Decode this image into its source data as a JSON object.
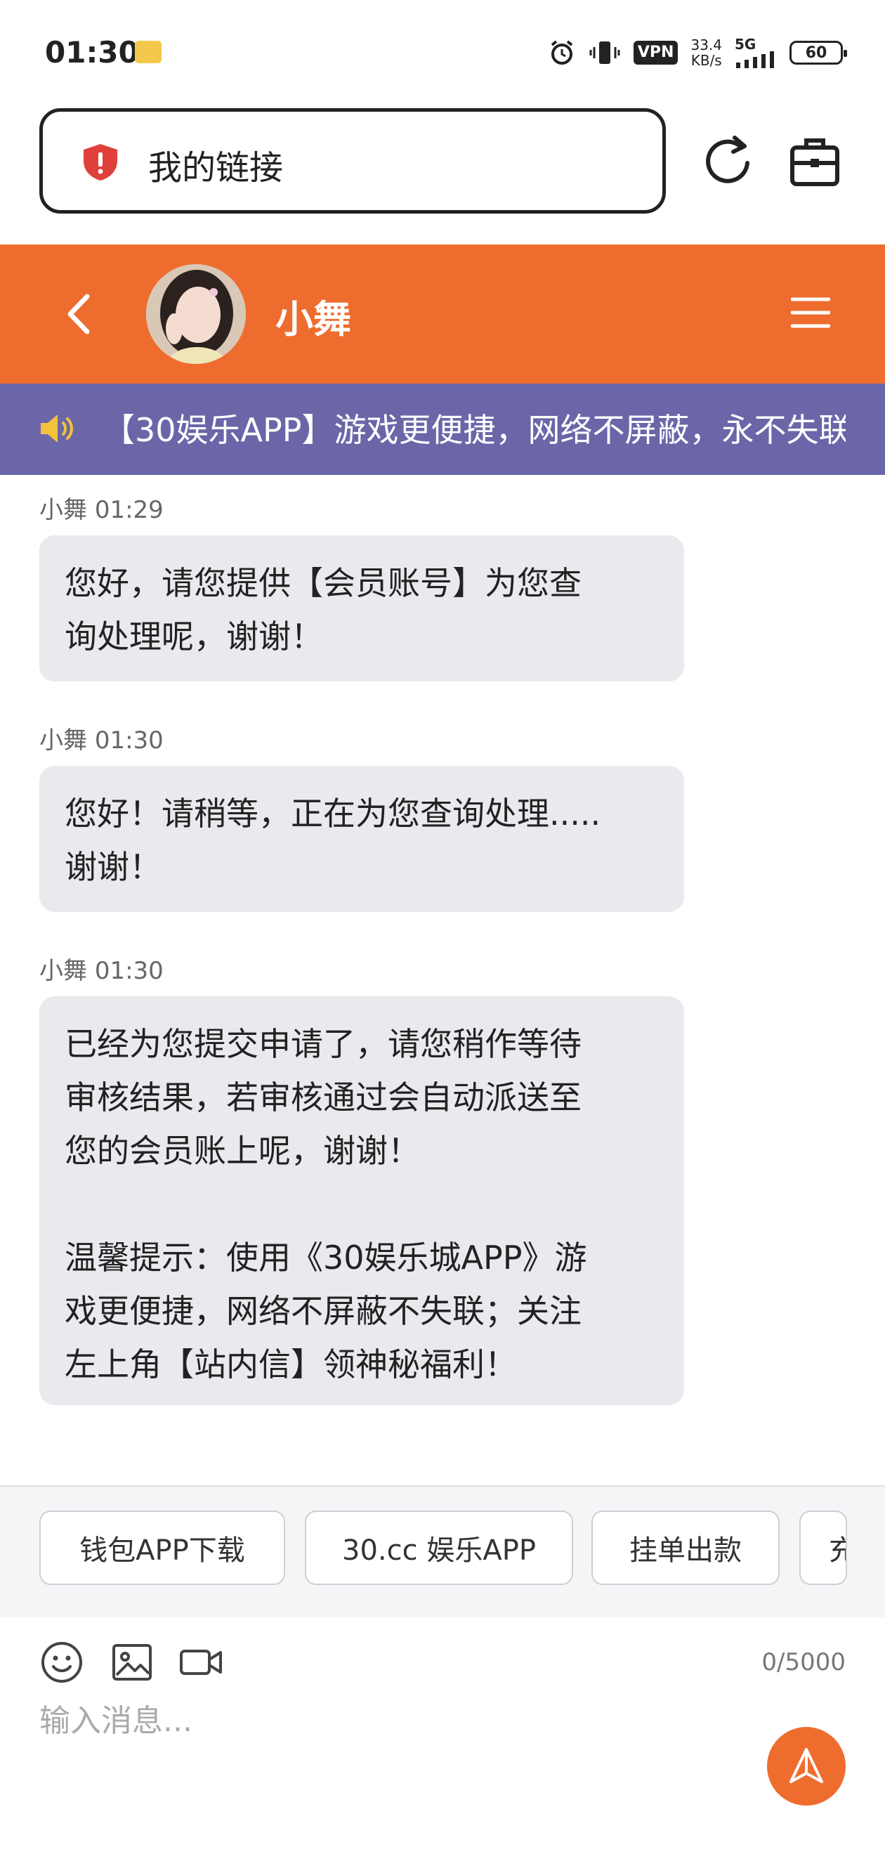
{
  "status": {
    "time": "01:30",
    "vpn": "VPN",
    "speed_value": "33.4",
    "speed_unit": "KB/s",
    "network": "5G",
    "battery": "60"
  },
  "browser": {
    "url_text": "我的链接"
  },
  "chat": {
    "agent_name": "小舞",
    "announcement": "【30娱乐APP】游戏更便捷，网络不屏蔽，永不失联"
  },
  "messages": [
    {
      "sender": "小舞",
      "time": "01:29",
      "text": "您好，请您提供【会员账号】为您查\n询处理呢，谢谢！"
    },
    {
      "sender": "小舞",
      "time": "01:30",
      "text": "您好！请稍等，正在为您查询处理.....\n谢谢！"
    },
    {
      "sender": "小舞",
      "time": "01:30",
      "text": "已经为您提交申请了，请您稍作等待\n审核结果，若审核通过会自动派送至\n您的会员账上呢，谢谢！\n\n温馨提示：使用《30娱乐城APP》游\n戏更便捷，网络不屏蔽不失联；关注\n左上角【站内信】领神秘福利！"
    }
  ],
  "quick_replies": [
    "钱包APP下载",
    "30.cc 娱乐APP",
    "挂单出款",
    "充"
  ],
  "composer": {
    "counter": "0/5000",
    "placeholder": "输入消息..."
  },
  "colors": {
    "header": "#ee6d2e",
    "marquee": "#6a66a8",
    "bubble": "#e9e9ee",
    "send": "#ee6d2e"
  }
}
